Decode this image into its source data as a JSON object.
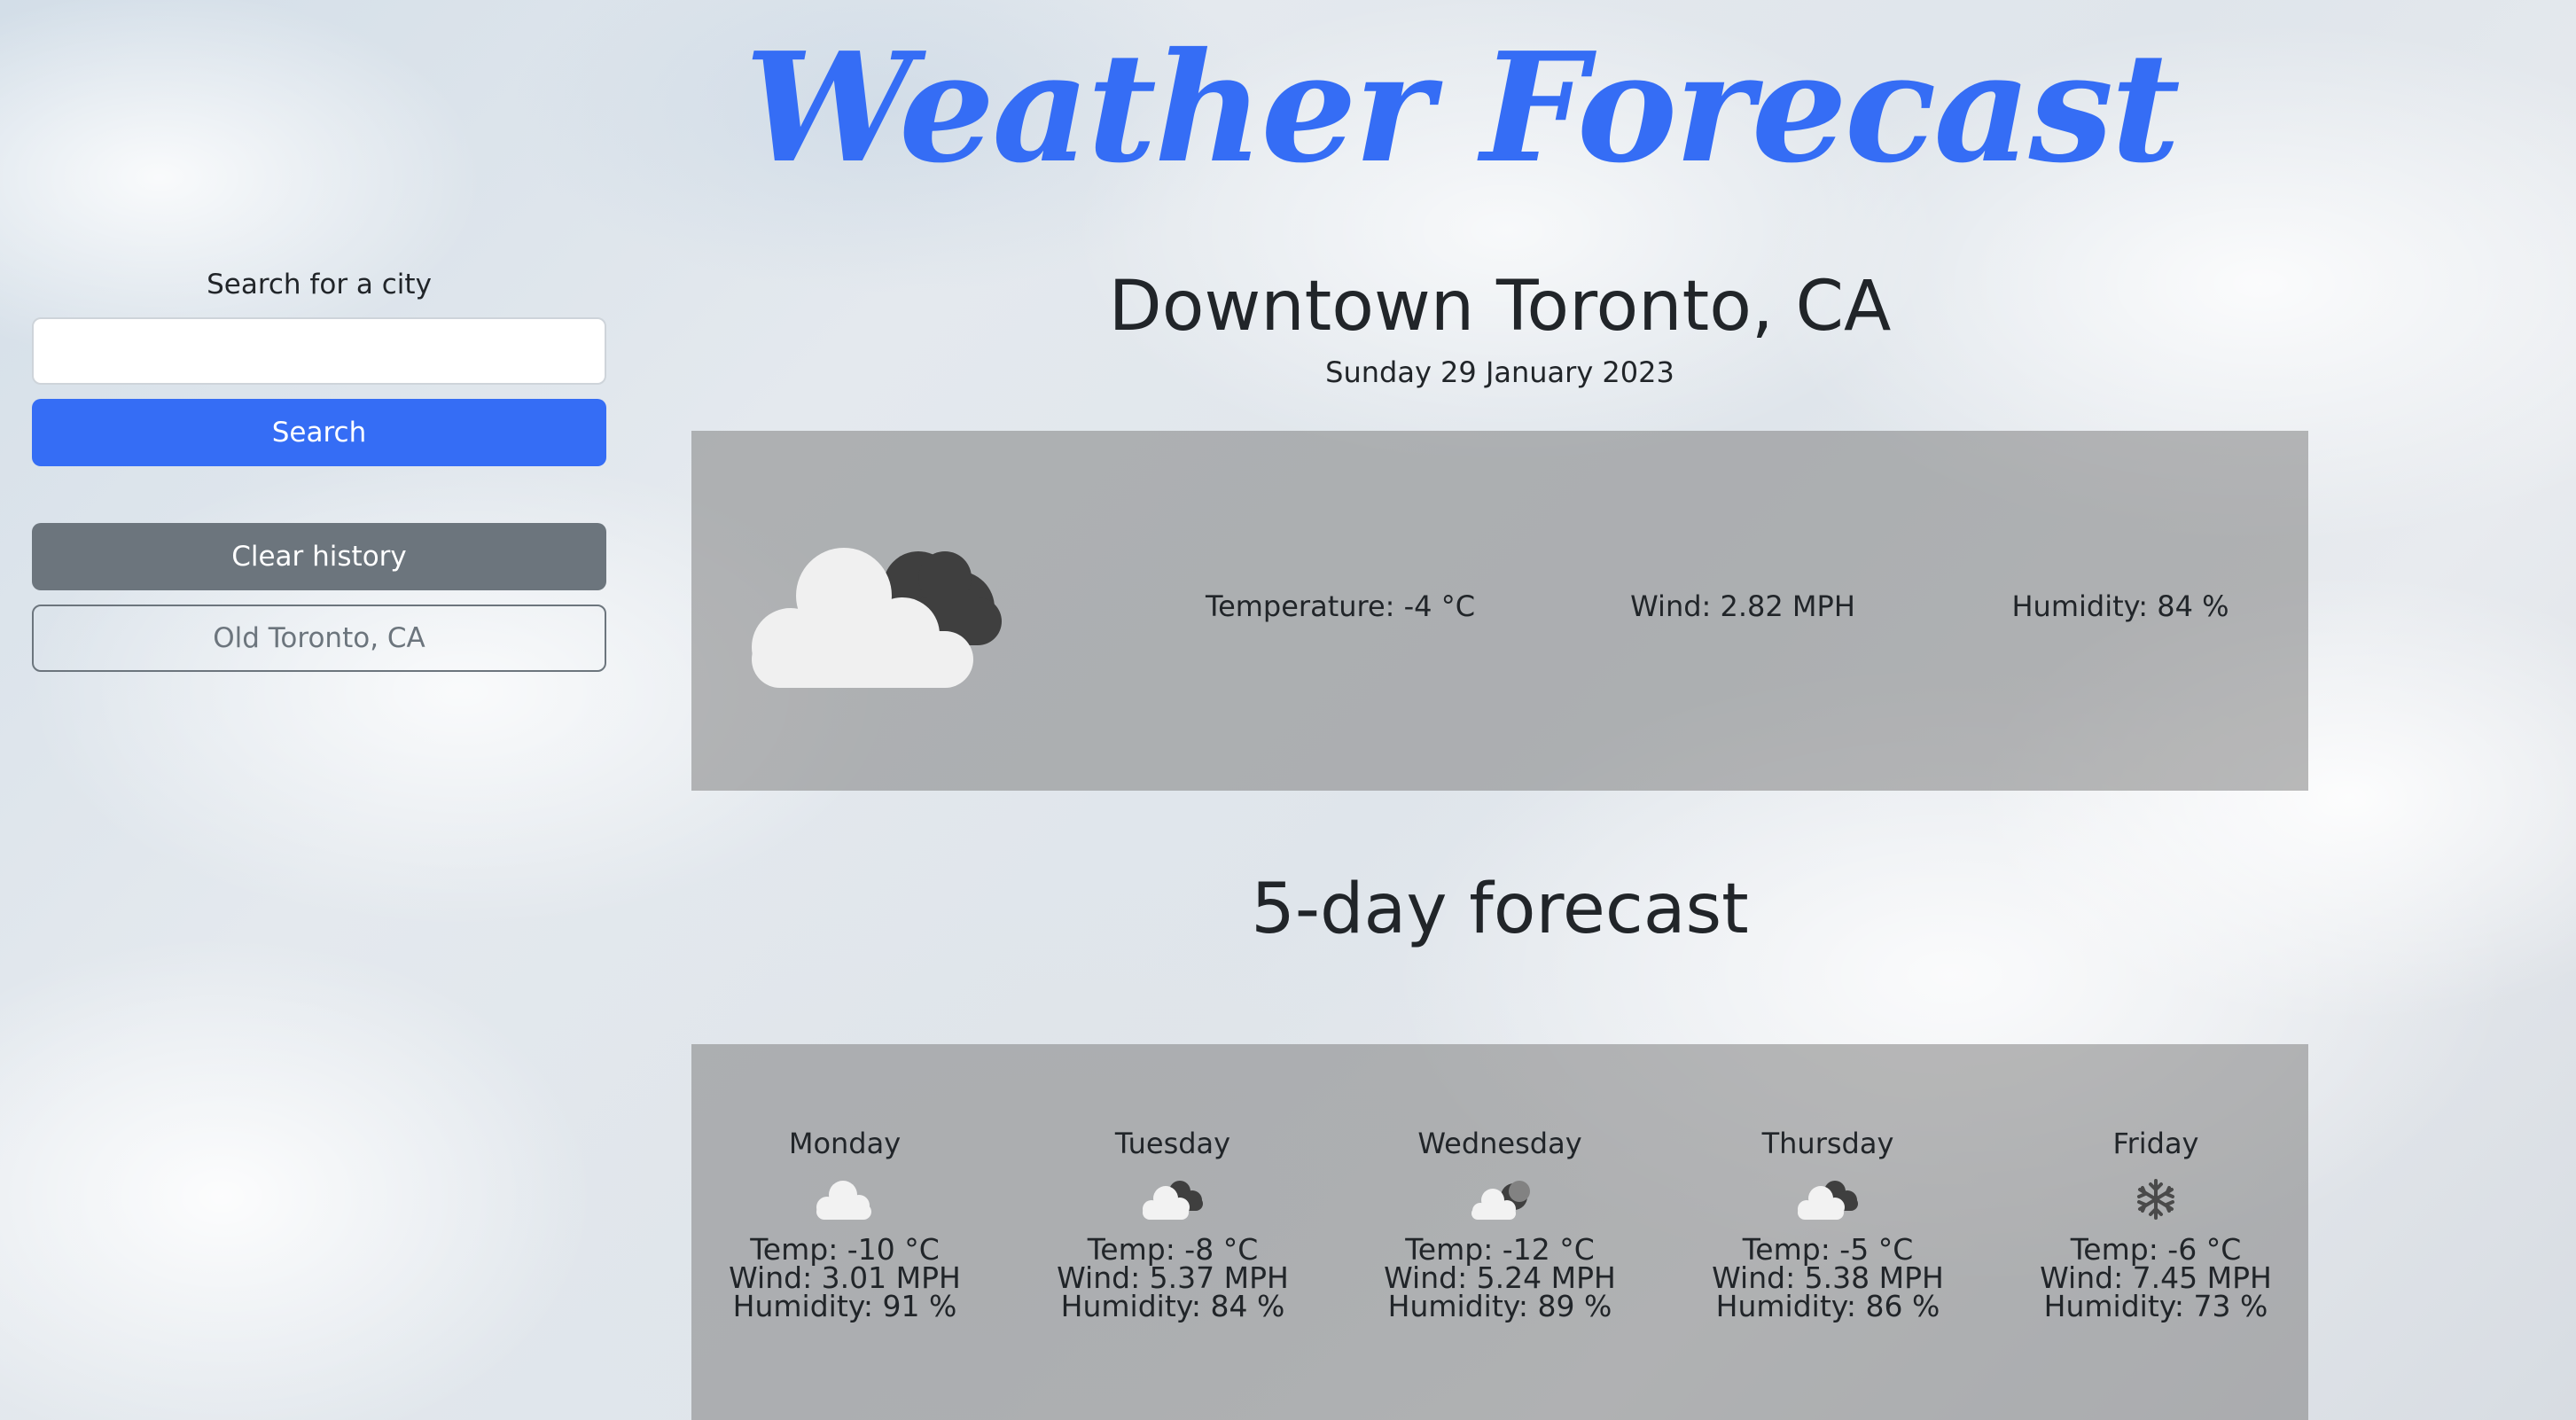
{
  "app": {
    "title": "Weather Forecast"
  },
  "sidebar": {
    "search_label": "Search for a city",
    "search_value": "",
    "search_placeholder": "",
    "search_button": "Search",
    "clear_button": "Clear history",
    "history": [
      "Old Toronto, CA"
    ]
  },
  "current": {
    "city": "Downtown Toronto, CA",
    "date": "Sunday 29 January 2023",
    "icon": "cloud-night-icon",
    "temperature": "Temperature: -4 °C",
    "wind": "Wind: 2.82 MPH",
    "humidity": "Humidity: 84 %"
  },
  "forecast": {
    "heading": "5-day forecast",
    "days": [
      {
        "day": "Monday",
        "icon": "cloud-icon",
        "temp": "Temp: -10 °C",
        "wind": "Wind: 3.01 MPH",
        "humidity": "Humidity: 91 %"
      },
      {
        "day": "Tuesday",
        "icon": "broken-clouds-icon",
        "temp": "Temp: -8 °C",
        "wind": "Wind: 5.37 MPH",
        "humidity": "Humidity: 84 %"
      },
      {
        "day": "Wednesday",
        "icon": "cloud-night-icon",
        "temp": "Temp: -12 °C",
        "wind": "Wind: 5.24 MPH",
        "humidity": "Humidity: 89 %"
      },
      {
        "day": "Thursday",
        "icon": "broken-clouds-icon",
        "temp": "Temp: -5 °C",
        "wind": "Wind: 5.38 MPH",
        "humidity": "Humidity: 86 %"
      },
      {
        "day": "Friday",
        "icon": "snowflake-icon",
        "temp": "Temp: -6 °C",
        "wind": "Wind: 7.45 MPH",
        "humidity": "Humidity: 73 %"
      }
    ]
  },
  "colors": {
    "accent": "#356df5",
    "secondary": "#6c757d",
    "panel": "#828282"
  }
}
